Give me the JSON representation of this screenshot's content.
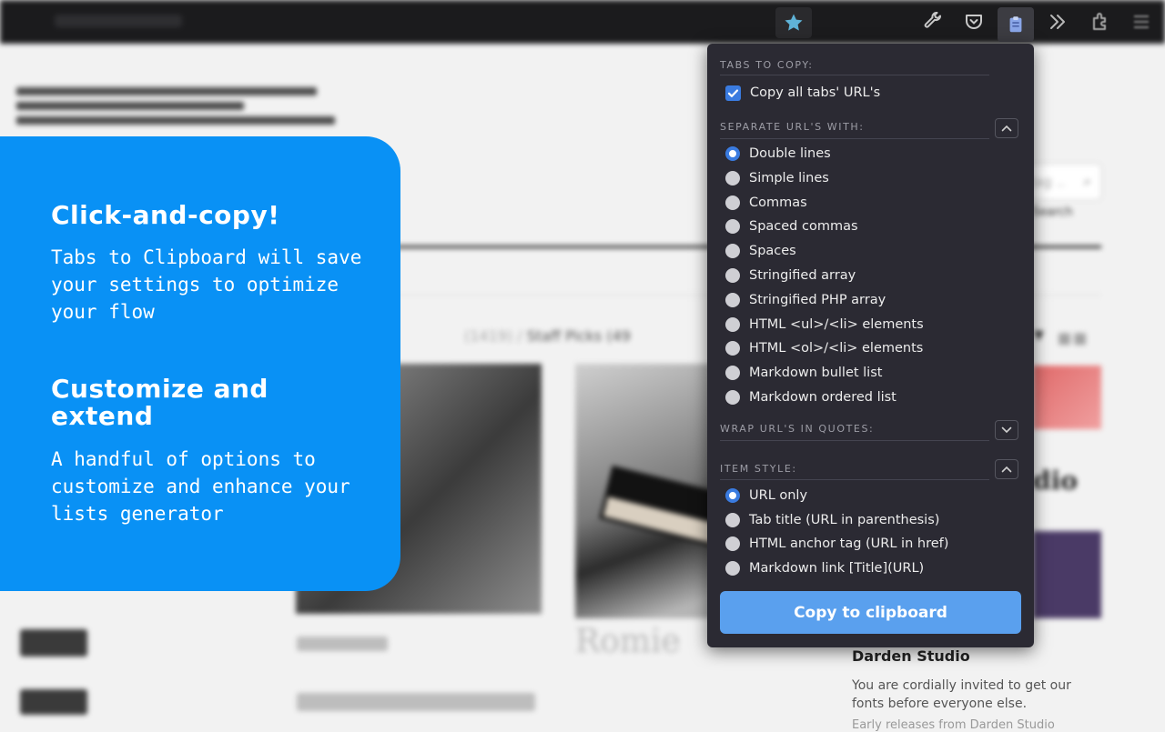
{
  "promo": {
    "heading1": "Click-and-copy!",
    "body1": "Tabs to Clipboard will save your settings to optimize your flow",
    "heading2": "Customize and extend",
    "body2": "A handful of options to customize and enhance your lists generator",
    "background_color": "#0991f5"
  },
  "toolbar": {
    "icons": [
      "star-icon",
      "wrench-icon",
      "pocket-icon",
      "tabs-to-clipboard-icon",
      "chevrons-right-icon",
      "extensions-icon",
      "menu-icon"
    ]
  },
  "popup": {
    "tabs_to_copy": {
      "label": "TABS TO COPY:",
      "copy_all_label": "Copy all tabs' URL's",
      "copy_all_checked": true
    },
    "separate": {
      "label": "SEPARATE URL'S WITH:",
      "selected": "Double lines",
      "options": [
        "Double lines",
        "Simple lines",
        "Commas",
        "Spaced commas",
        "Spaces",
        "Stringified array",
        "Stringified PHP array",
        "HTML <ul>/<li> elements",
        "HTML <ol>/<li> elements",
        "Markdown bullet list",
        "Markdown ordered list"
      ]
    },
    "wrap": {
      "label": "WRAP URL'S IN QUOTES:"
    },
    "item_style": {
      "label": "ITEM STYLE:",
      "selected": "URL only",
      "options": [
        "URL only",
        "Tab title (URL in parenthesis)",
        "HTML anchor tag (URL in href)",
        "Markdown link [Title](URL)"
      ]
    },
    "copy_button_label": "Copy to clipboard",
    "accent_color": "#3a7be0",
    "button_color": "#5aa0ee"
  },
  "background_page": {
    "search_placeholder": "tag ..",
    "search_label": "Search",
    "breadcrumb_muted": "(1419) /",
    "breadcrumb_current": "Staff Picks (49",
    "feature_word": "dio",
    "card_title_serif": "Romie",
    "darden_title": "Darden Studio",
    "darden_desc": "You are cordially invited to get our fonts before everyone else.",
    "darden_more": "Early releases from Darden Studio"
  }
}
